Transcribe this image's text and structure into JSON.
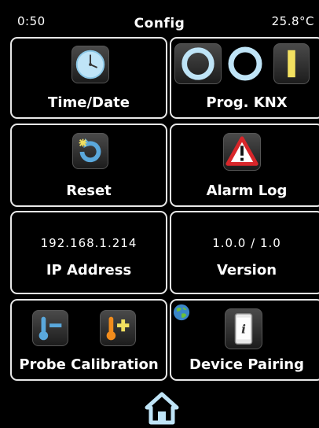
{
  "status": {
    "time": "0:50",
    "title": "Config",
    "temperature": "25.8°C"
  },
  "tiles": {
    "time_date": {
      "label": "Time/Date",
      "icon": "clock-icon"
    },
    "prog_knx": {
      "label": "Prog. KNX",
      "icon": "knx-icon"
    },
    "reset": {
      "label": "Reset",
      "icon": "reset-icon"
    },
    "alarm_log": {
      "label": "Alarm Log",
      "icon": "warning-icon"
    },
    "ip_address": {
      "label": "IP Address",
      "value": "192.168.1.214"
    },
    "version": {
      "label": "Version",
      "value": "1.0.0 / 1.0"
    },
    "probe_calibration": {
      "label": "Probe Calibration",
      "icons": [
        "thermometer-minus-icon",
        "thermometer-plus-icon"
      ]
    },
    "device_pairing": {
      "label": "Device Pairing",
      "icons": [
        "globe-icon",
        "phone-info-icon"
      ]
    }
  },
  "nav": {
    "home_icon": "home-icon"
  },
  "colors": {
    "accent_blue": "#5aa8dc",
    "knx_yellow": "#f2e060",
    "warning_red": "#d8262a",
    "tile_border": "#e8e8e8",
    "background": "#000000"
  }
}
